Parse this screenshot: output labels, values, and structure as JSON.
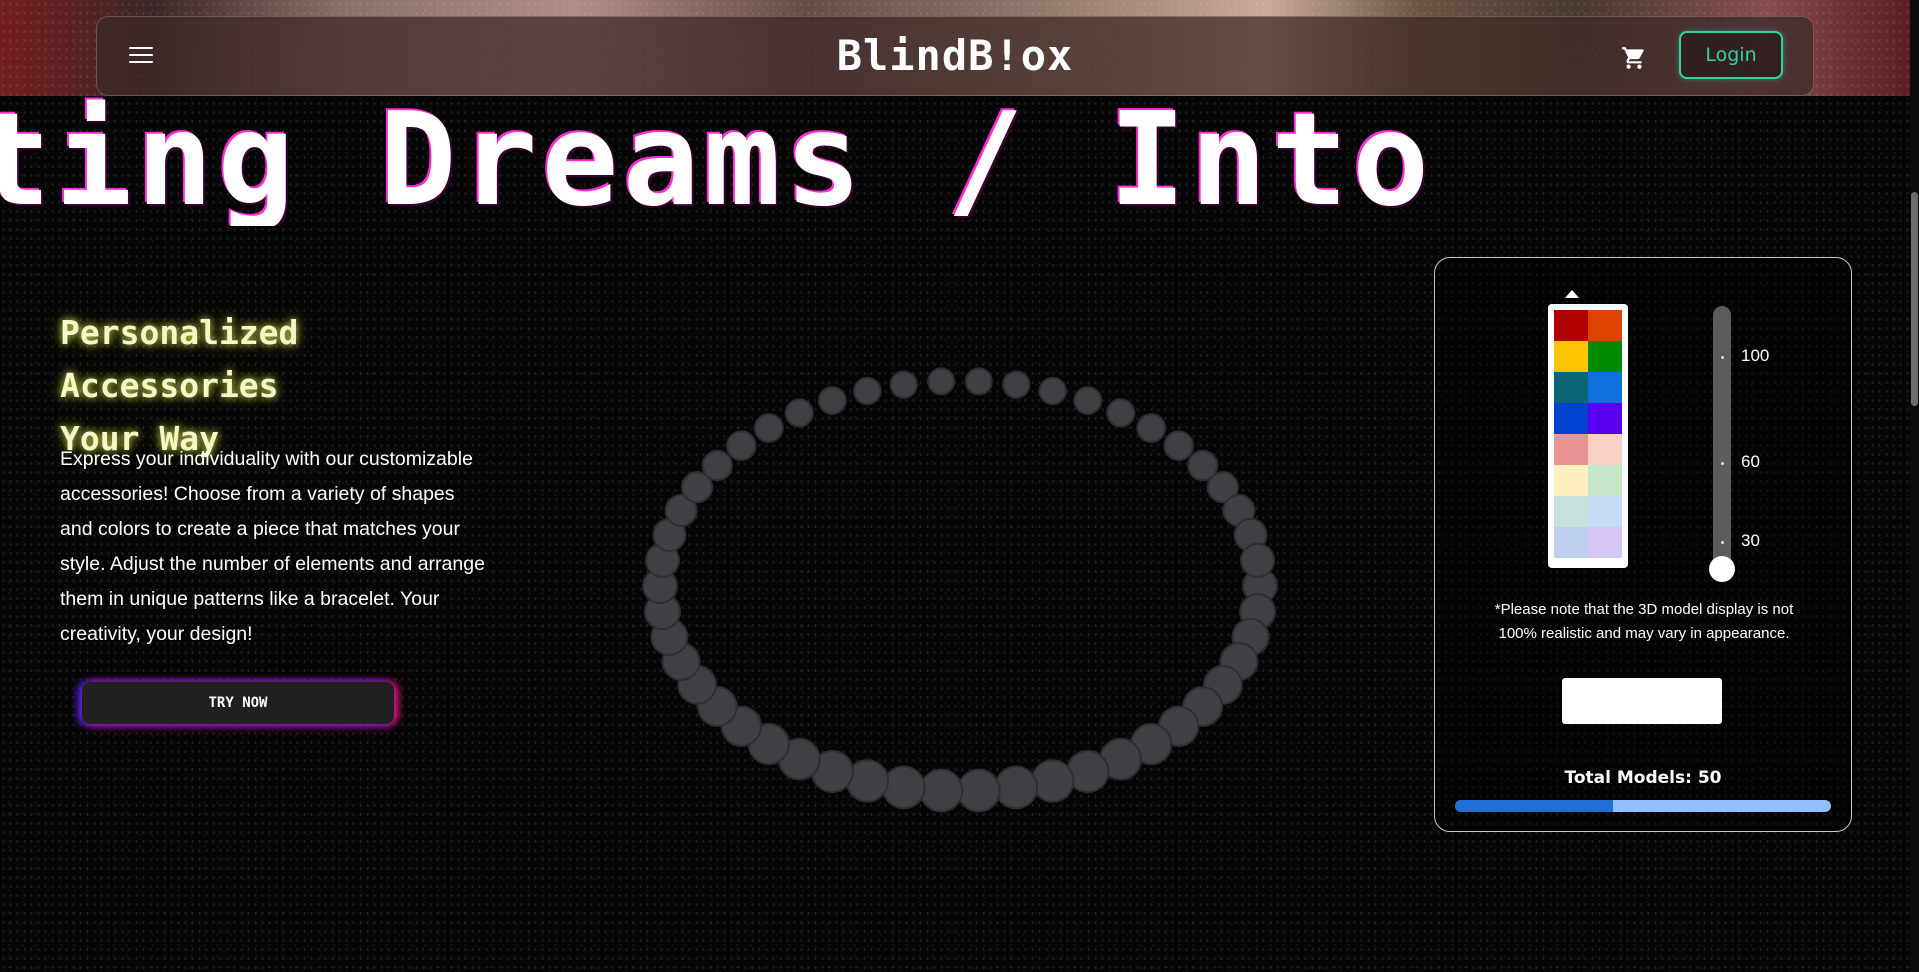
{
  "header": {
    "brand": "BlindB!ox",
    "login_label": "Login",
    "menu_icon": "menu-icon",
    "cart_icon": "cart-icon"
  },
  "marquee": {
    "text": "ting Dreams / Into "
  },
  "hero": {
    "title_line1": "Personalized Accessories",
    "title_line2": "Your Way",
    "description": "Express your individuality with our customizable accessories! Choose from a variety of shapes and colors to create a piece that matches your style. Adjust the number of elements and arrange them in unique patterns like a bracelet. Your creativity, your design!",
    "cta_label": "TRY NOW"
  },
  "bracelet": {
    "bead_color": "#3e4045"
  },
  "config": {
    "palette": [
      "#b00000",
      "#dd4400",
      "#ffc400",
      "#008a00",
      "#0a6675",
      "#1070e0",
      "#0043d0",
      "#5a00f0",
      "#ea9494",
      "#f8d0c4",
      "#fff0c0",
      "#c6e6c8",
      "#c6e2de",
      "#c4dcf4",
      "#bed0f2",
      "#d6c6f6"
    ],
    "slider_ticks": [
      "100",
      "60",
      "30"
    ],
    "slider_value": 30,
    "note_line1": "*Please note that the 3D model display is not",
    "note_line2": "100% realistic and may vary in appearance.",
    "input_value": "",
    "total_label": "Total Models: 50",
    "progress_fraction": 0.42
  },
  "colors": {
    "accent_green": "#2ed3a3",
    "title_yellow": "#f6f7c8",
    "progress_fill": "#1f6fd6",
    "progress_track": "#90c0ff"
  }
}
